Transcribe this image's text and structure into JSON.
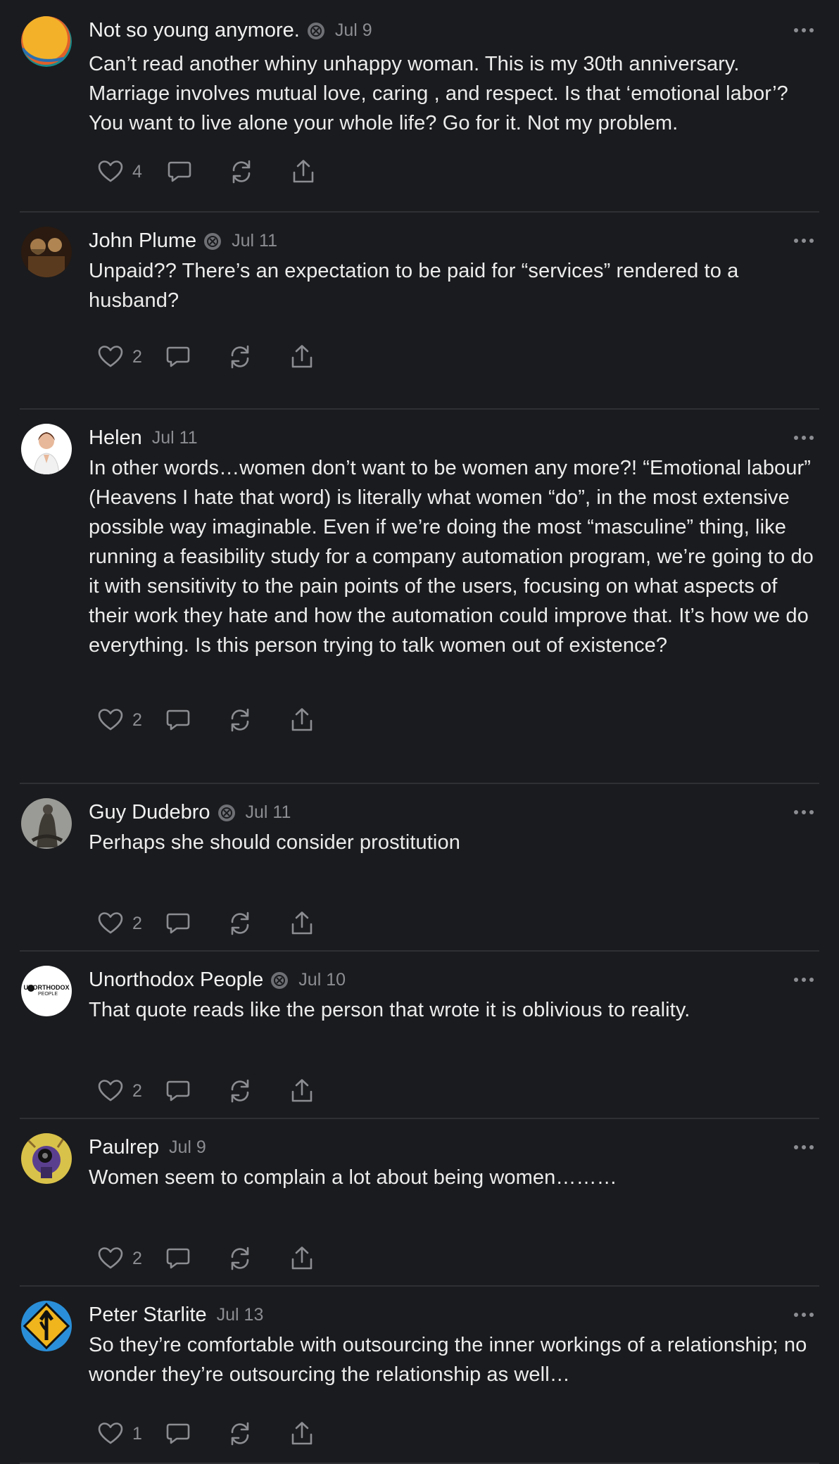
{
  "comments": [
    {
      "name": "Not so young anymore.",
      "date": "Jul 9",
      "badge": true,
      "avatar": "orange-circle-avatar",
      "text": "Can’t read another whiny unhappy woman. This is my 30th anniversary. Marriage involves mutual love, caring , and respect. Is that ‘emotional labor’? You want to live alone your whole life? Go for it. Not my problem.",
      "likes": "4"
    },
    {
      "name": "John Plume",
      "date": "Jul 11",
      "badge": true,
      "avatar": "painting-avatar",
      "text": "Unpaid?? There’s an expectation to be paid for “services” rendered to a husband?",
      "likes": "2"
    },
    {
      "name": "Helen",
      "date": "Jul 11",
      "badge": false,
      "avatar": "woman-photo-avatar",
      "text": "In other words…women don’t want to be women any more?! “Emotional labour” (Heavens I hate that word) is literally what women “do”, in the most extensive possible way imaginable. Even if we’re doing the most “masculine” thing, like running a feasibility study for a company automation program, we’re going to do it with sensitivity to the pain points of the users, focusing on what aspects of their work they hate and how the automation could improve that. It’s how we do everything. Is this person trying to talk women out of existence?",
      "likes": "2"
    },
    {
      "name": "Guy Dudebro",
      "date": "Jul 11",
      "badge": true,
      "avatar": "statue-avatar",
      "text": "Perhaps she should consider prostitution",
      "likes": "2"
    },
    {
      "name": "Unorthodox People",
      "date": "Jul 10",
      "badge": true,
      "avatar": "unorthodox-people-logo-avatar",
      "avatar_text": [
        "UNORTHODOX",
        "PEOPLE"
      ],
      "text": "That quote reads like the person that wrote it is oblivious to reality.",
      "likes": "2"
    },
    {
      "name": "Paulrep",
      "date": "Jul 9",
      "badge": false,
      "avatar": "cartoon-avatar",
      "text": "Women seem to complain a lot about being women………",
      "likes": "2"
    },
    {
      "name": "Peter Starlite",
      "date": "Jul 13",
      "badge": false,
      "avatar": "merge-sign-avatar",
      "text": "So they’re comfortable with outsourcing the inner workings of a relationship; no wonder they’re outsourcing the relationship as well…",
      "likes": "1"
    }
  ],
  "icons": {
    "like": "heart-icon",
    "reply": "comment-icon",
    "restack": "restack-icon",
    "share": "share-icon",
    "more": "more-options-icon",
    "badge": "subscriber-badge-icon"
  },
  "colors": {
    "background": "#1a1b1e",
    "text": "#ececec",
    "muted": "#8b8d92",
    "divider": "#2e3034"
  }
}
